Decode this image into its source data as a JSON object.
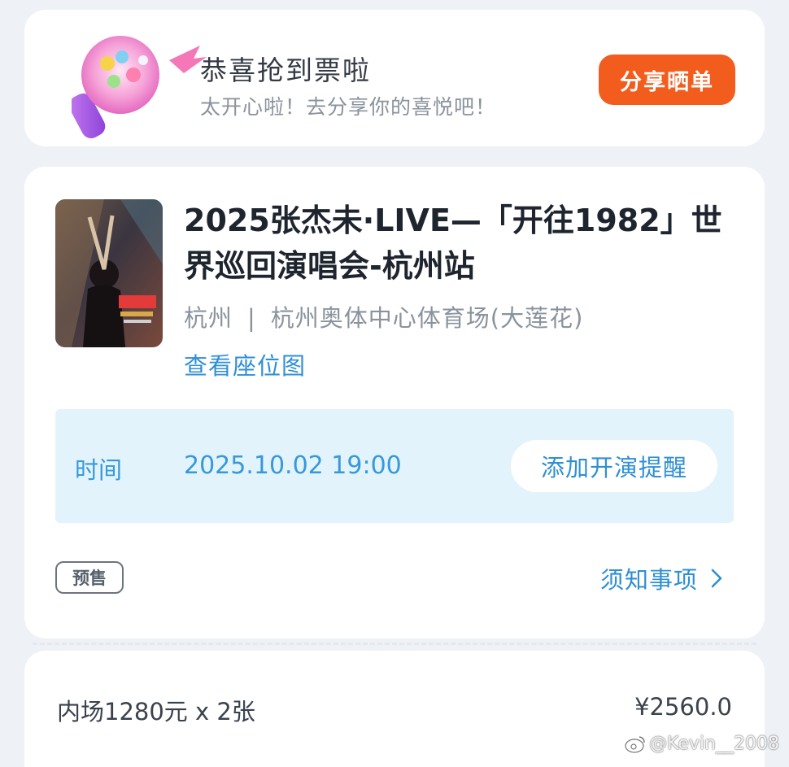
{
  "congrats": {
    "title": "恭喜抢到票啦",
    "subtitle": "太开心啦！去分享你的喜悦吧！",
    "share_button": "分享晒单"
  },
  "event": {
    "title": "2025张杰未·LIVE—「开往1982」世界巡回演唱会-杭州站",
    "city": "杭州",
    "separator": "|",
    "venue": "杭州奥体中心体育场(大莲花)",
    "seat_map_link": "查看座位图",
    "time_label": "时间",
    "time_value": "2025.10.02 19:00",
    "remind_button": "添加开演提醒",
    "presale_badge": "预售",
    "notice_link": "须知事项"
  },
  "price": {
    "item": "内场1280元 x 2张",
    "total": "¥2560.0"
  },
  "watermark": "@Kevin__2008",
  "colors": {
    "accent_orange": "#f25d1e",
    "link_blue": "#2f8fd4",
    "time_bg": "#e3f3fc"
  }
}
